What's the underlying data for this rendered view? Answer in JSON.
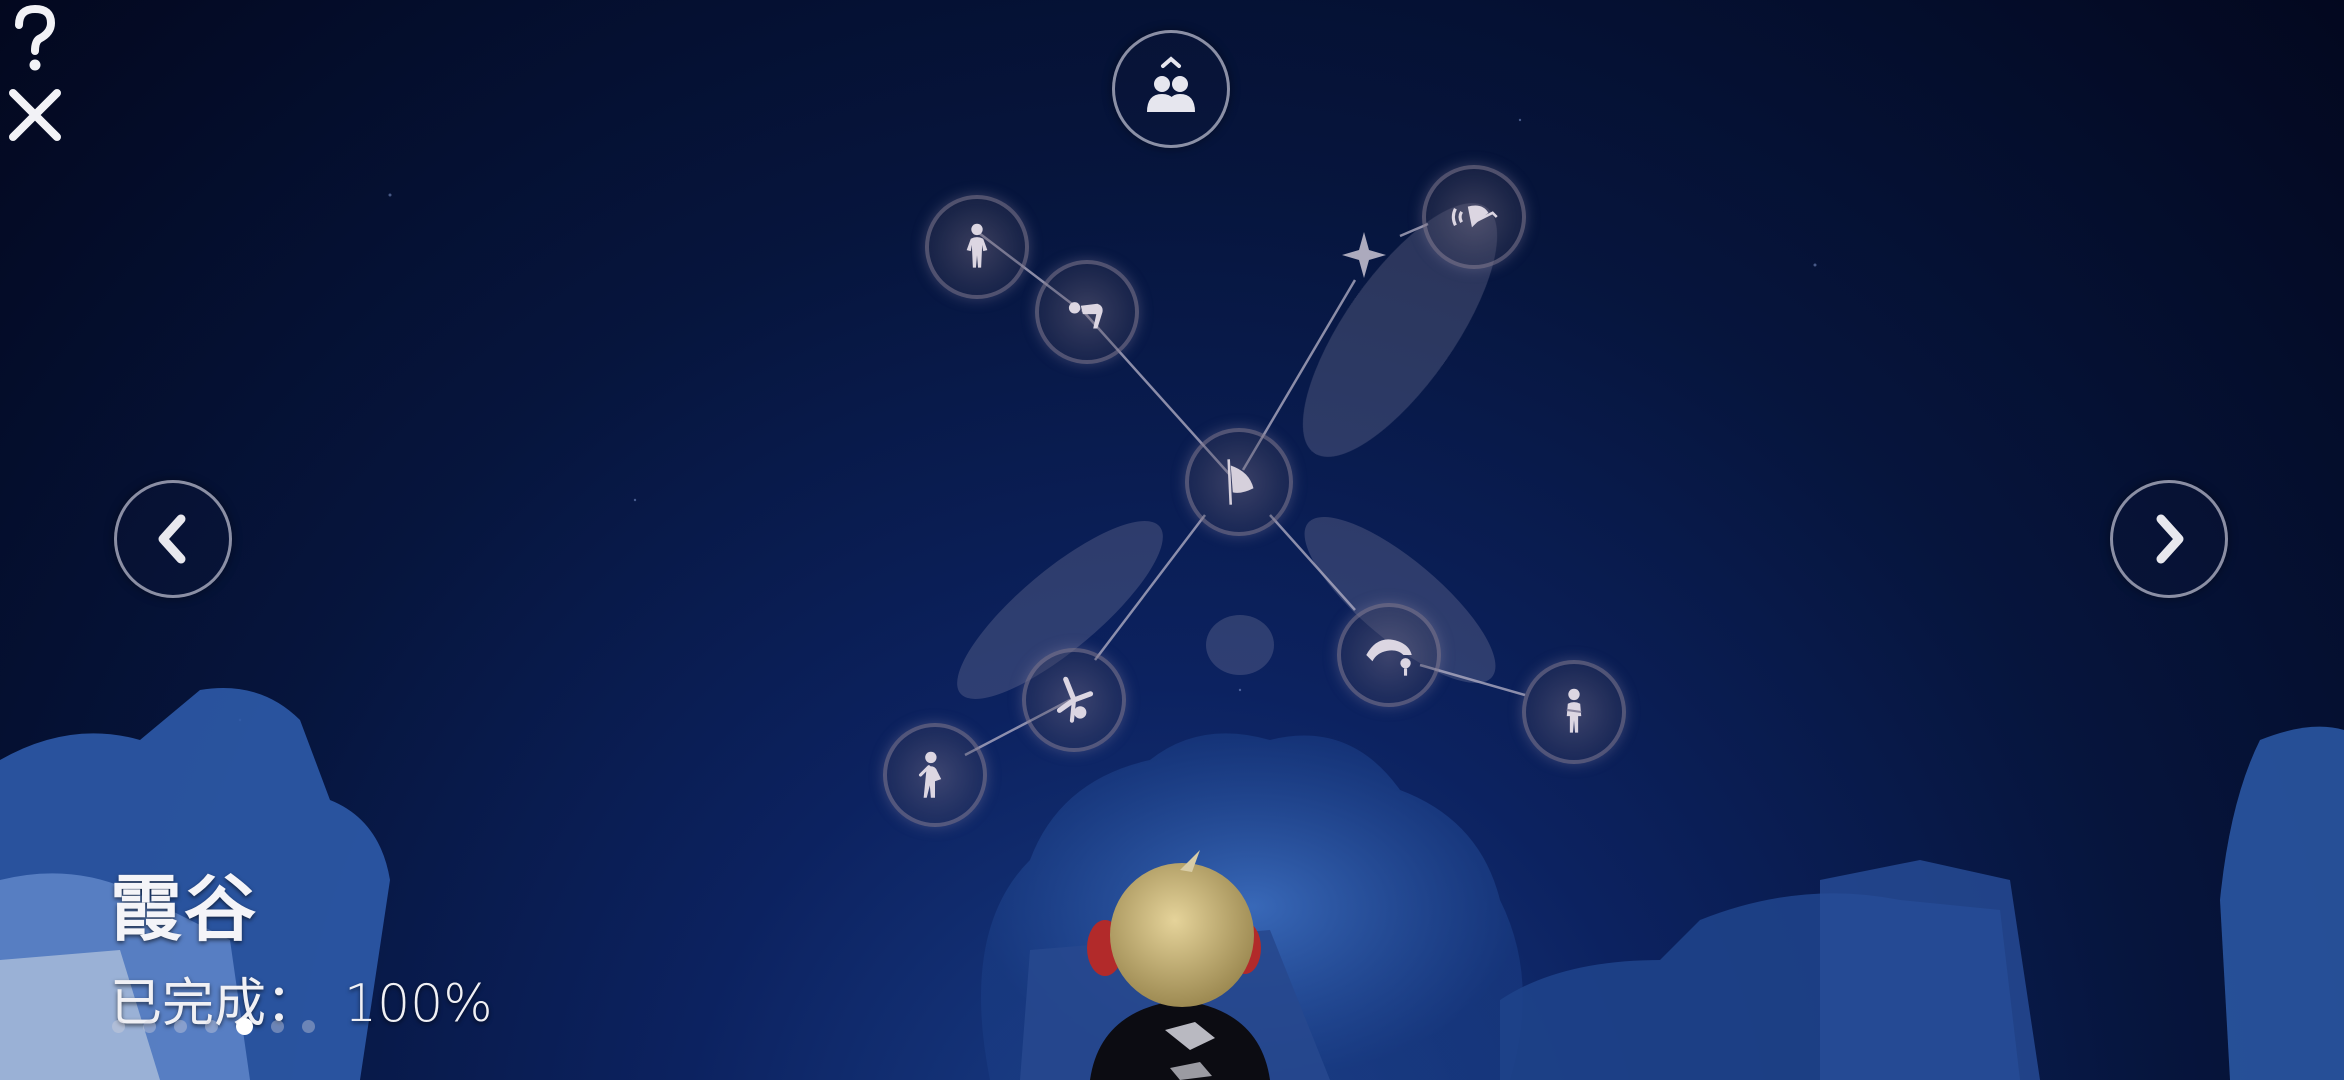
{
  "area": {
    "name": "霞谷",
    "completion_label": "已完成：",
    "completion_value": "100%"
  },
  "pagination": {
    "total": 7,
    "active_index": 4
  },
  "top_bar": {
    "friends_icon": "friends-icon",
    "help_icon": "help-icon",
    "close_icon": "close-icon"
  },
  "navigation": {
    "prev_icon": "chevron-left-icon",
    "next_icon": "chevron-right-icon"
  },
  "constellation": {
    "center_icon": "cape-spirit-icon",
    "nodes": [
      {
        "name": "spirit-node-standing",
        "icon": "standing-pose-icon"
      },
      {
        "name": "spirit-node-bow",
        "icon": "bow-pose-icon"
      },
      {
        "name": "spirit-node-sound",
        "icon": "sound-ear-icon"
      },
      {
        "name": "spirit-node-cartwheel",
        "icon": "cartwheel-pose-icon"
      },
      {
        "name": "spirit-node-stretch",
        "icon": "stretch-pose-icon"
      },
      {
        "name": "spirit-node-backflip",
        "icon": "backflip-pose-icon"
      },
      {
        "name": "spirit-node-crossed-arms",
        "icon": "crossed-arms-pose-icon"
      }
    ]
  },
  "colors": {
    "node_glow": "#9a90aa",
    "line": "#b8b4c8",
    "text": "#f0f0f4"
  }
}
